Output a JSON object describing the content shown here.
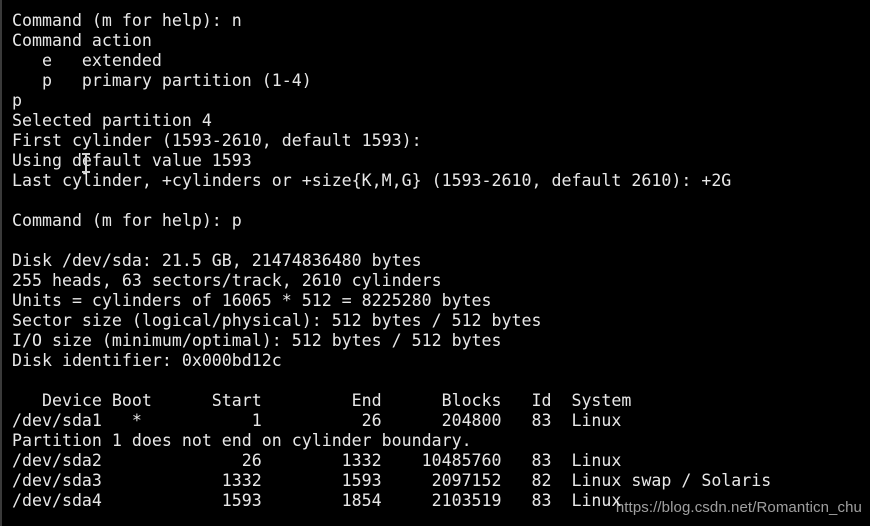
{
  "terminal": {
    "lines": [
      "Command (m for help): n",
      "Command action",
      "   e   extended",
      "   p   primary partition (1-4)",
      "p",
      "Selected partition 4",
      "First cylinder (1593-2610, default 1593):",
      "Using default value 1593",
      "Last cylinder, +cylinders or +size{K,M,G} (1593-2610, default 2610): +2G",
      "",
      "Command (m for help): p",
      "",
      "Disk /dev/sda: 21.5 GB, 21474836480 bytes",
      "255 heads, 63 sectors/track, 2610 cylinders",
      "Units = cylinders of 16065 * 512 = 8225280 bytes",
      "Sector size (logical/physical): 512 bytes / 512 bytes",
      "I/O size (minimum/optimal): 512 bytes / 512 bytes",
      "Disk identifier: 0x000bd12c",
      "",
      "   Device Boot      Start         End      Blocks   Id  System",
      "/dev/sda1   *           1          26      204800   83  Linux",
      "Partition 1 does not end on cylinder boundary.",
      "/dev/sda2              26        1332    10485760   83  Linux",
      "/dev/sda3            1332        1593     2097152   82  Linux swap / Solaris",
      "/dev/sda4            1593        1854     2103519   83  Linux"
    ]
  },
  "watermark": "https://blog.csdn.net/Romanticn_chu"
}
